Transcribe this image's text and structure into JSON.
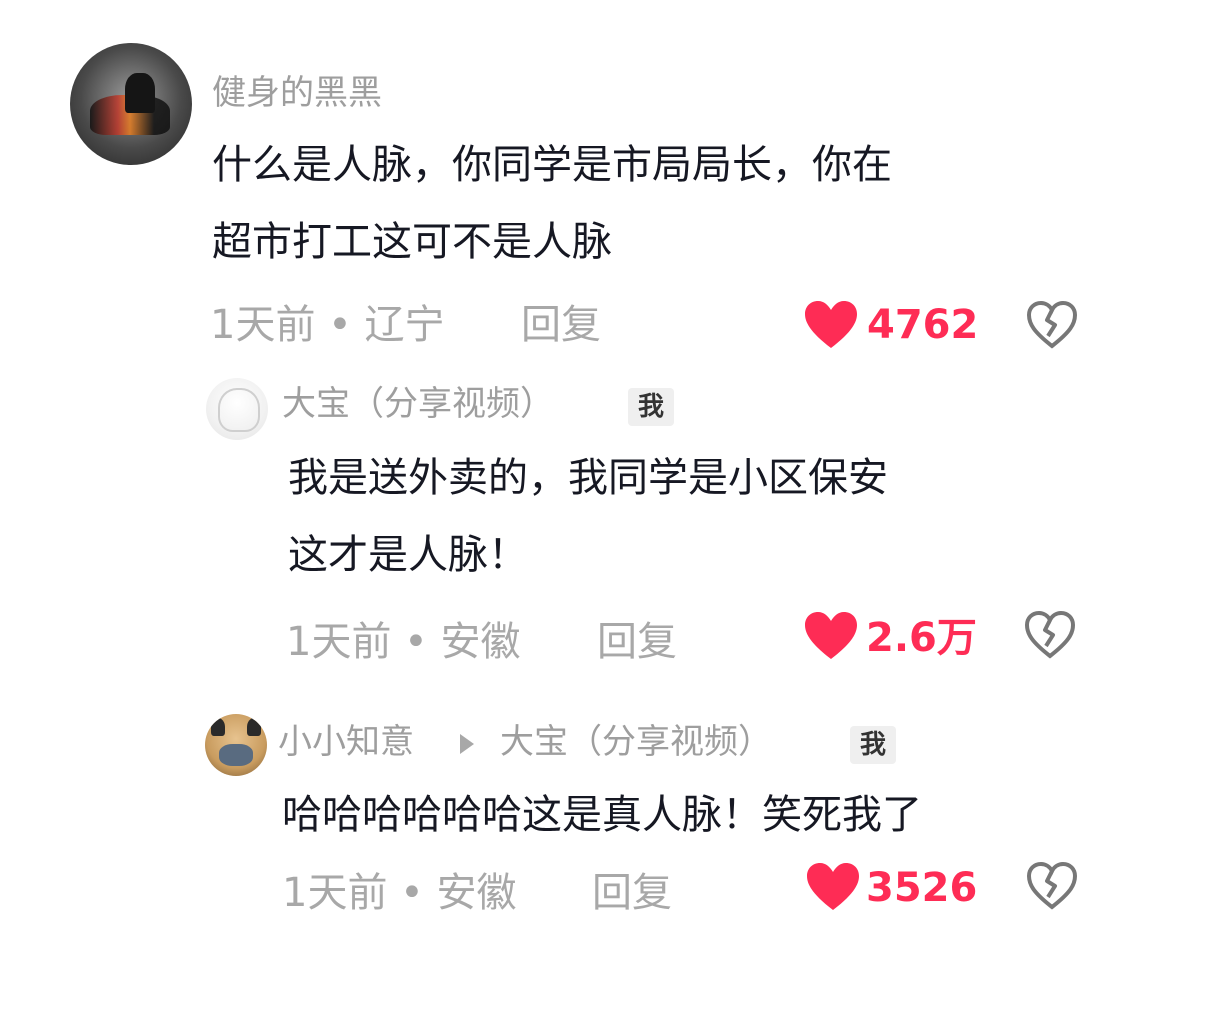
{
  "comment": {
    "username": "健身的黑黑",
    "lines": [
      "什么是人脉，你同学是市局局长，你在",
      "超市打工这可不是人脉"
    ],
    "meta": "1天前 • 辽宁",
    "reply_label": "回复",
    "likes": "4762"
  },
  "replies": [
    {
      "username": "大宝（分享视频）",
      "badge": "我",
      "lines": [
        "我是送外卖的，我同学是小区保安",
        "这才是人脉！"
      ],
      "meta": "1天前 • 安徽",
      "reply_label": "回复",
      "likes": "2.6万"
    },
    {
      "username": "小小知意",
      "reply_to": "大宝（分享视频）",
      "badge": "我",
      "lines": [
        "哈哈哈哈哈哈这是真人脉！笑死我了"
      ],
      "meta": "1天前 • 安徽",
      "reply_label": "回复",
      "likes": "3526"
    }
  ],
  "colors": {
    "like_accent": "#fe2c55",
    "meta_gray": "#a8a8a8",
    "text_dark": "#161823"
  },
  "icons": {
    "like": "heart-icon",
    "dislike": "broken-heart-icon",
    "reply_arrow": "triangle-right-icon"
  }
}
